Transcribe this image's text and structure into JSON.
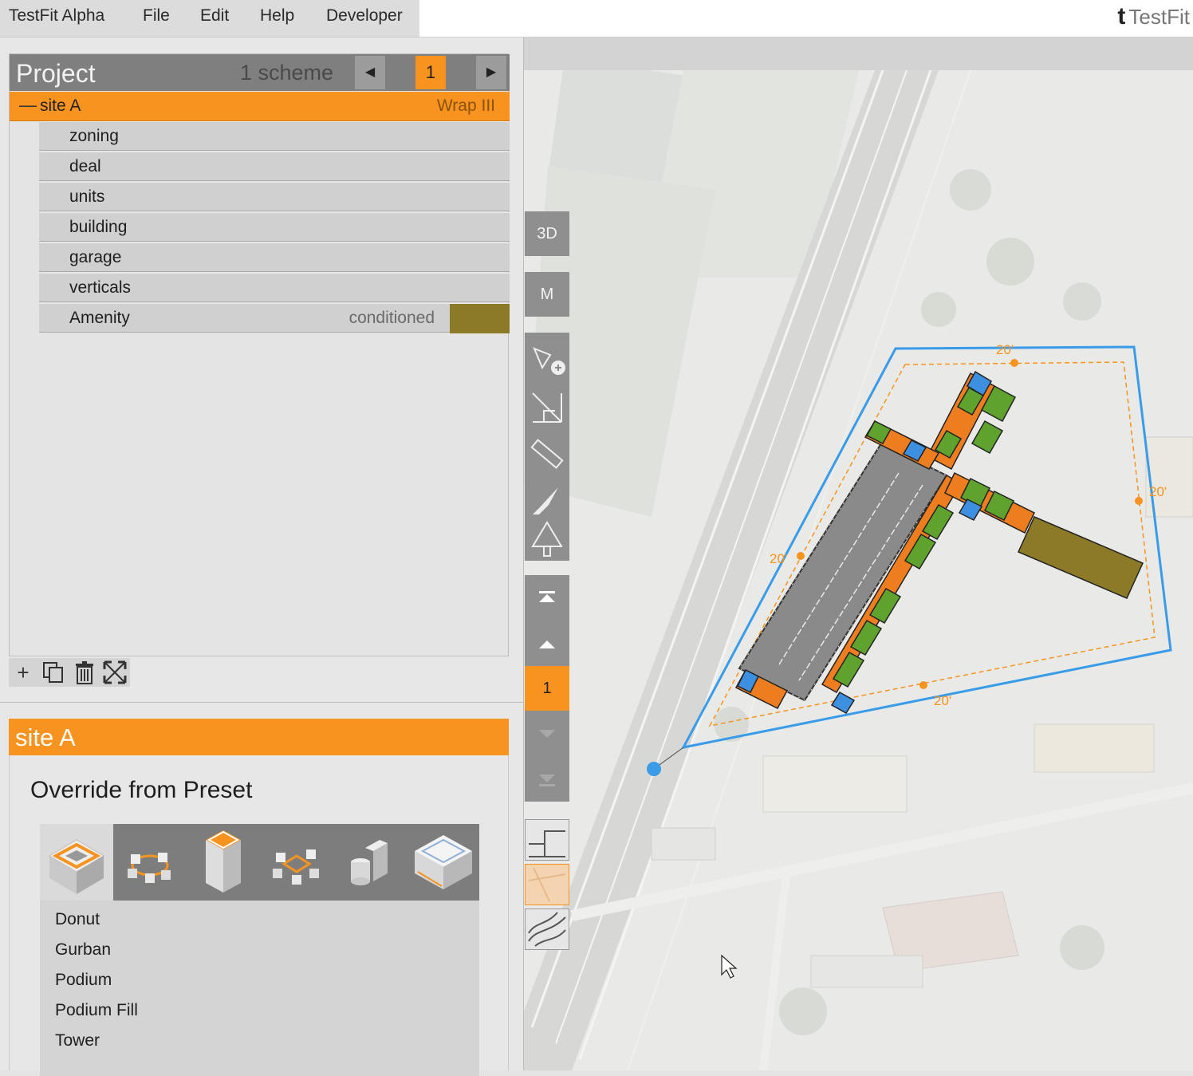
{
  "menubar": {
    "items": [
      "TestFit Alpha",
      "File",
      "Edit",
      "Help",
      "Developer"
    ]
  },
  "brand": {
    "logo_text": "TestFit",
    "logo_mark": "t"
  },
  "project": {
    "title": "Project",
    "scheme_count": "1 scheme",
    "current_scheme": "1",
    "site": {
      "name": "site A",
      "type": "Wrap III",
      "collapse_glyph": "—"
    },
    "tree_items": [
      "zoning",
      "deal",
      "units",
      "building",
      "garage",
      "verticals"
    ],
    "amenity": {
      "label": "Amenity",
      "value": "conditioned",
      "color": "#8c7a28"
    }
  },
  "site_panel": {
    "title": "site A",
    "override_title": "Override from Preset",
    "presets": [
      "Donut",
      "Gurban",
      "Podium",
      "Podium Fill",
      "Tower"
    ]
  },
  "map_tools": {
    "view_3d": "3D",
    "view_m": "M",
    "level": "1"
  },
  "map": {
    "setback_labels": [
      "20'",
      "20'",
      "20'",
      "20'"
    ]
  },
  "colors": {
    "accent": "#f7931e",
    "site_boundary": "#3a9be8",
    "unit_green": "#5fa32e",
    "unit_orange": "#ee7d1f",
    "unit_blue": "#3d8fe0",
    "amenity": "#8c7a28",
    "parking": "#8a8a8a"
  }
}
